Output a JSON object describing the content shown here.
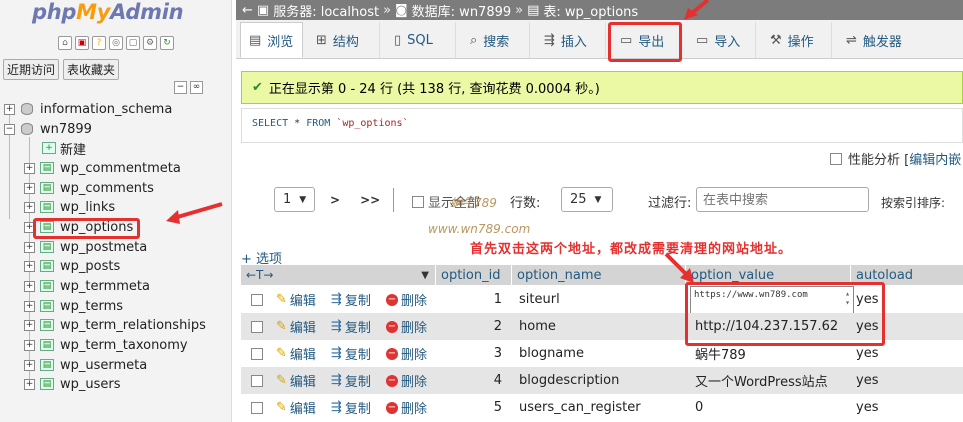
{
  "sidebar": {
    "logo_php": "php",
    "logo_my": "My",
    "logo_admin": "Admin",
    "quick_icons": [
      "home-icon",
      "exit-icon",
      "settings-icon",
      "docs-icon",
      "sql-icon",
      "gear-icon",
      "reload-icon"
    ],
    "nav_tabs": [
      "近期访问",
      "表收藏夹"
    ],
    "tree": [
      {
        "label": "information_schema",
        "type": "db",
        "expand": "+"
      },
      {
        "label": "wn7899",
        "type": "db",
        "expand": "-"
      },
      {
        "label": "新建",
        "type": "new"
      },
      {
        "label": "wp_commentmeta",
        "type": "table"
      },
      {
        "label": "wp_comments",
        "type": "table"
      },
      {
        "label": "wp_links",
        "type": "table"
      },
      {
        "label": "wp_options",
        "type": "table",
        "selected": true
      },
      {
        "label": "wp_postmeta",
        "type": "table"
      },
      {
        "label": "wp_posts",
        "type": "table"
      },
      {
        "label": "wp_termmeta",
        "type": "table"
      },
      {
        "label": "wp_terms",
        "type": "table"
      },
      {
        "label": "wp_term_relationships",
        "type": "table"
      },
      {
        "label": "wp_term_taxonomy",
        "type": "table"
      },
      {
        "label": "wp_usermeta",
        "type": "table"
      },
      {
        "label": "wp_users",
        "type": "table"
      }
    ]
  },
  "breadcrumb": {
    "server_label": "服务器: localhost",
    "db_label": "数据库: wn7899",
    "table_label": "表: wp_options"
  },
  "tabs": [
    "浏览",
    "结构",
    "SQL",
    "搜索",
    "插入",
    "导出",
    "导入",
    "操作",
    "触发器"
  ],
  "success": {
    "text": "正在显示第 0 - 24 行 (共 138 行, 查询花费 0.0004 秒。)"
  },
  "sql": {
    "select": "SELECT",
    "star": " * ",
    "from": "FROM",
    "table": "`wp_options`"
  },
  "profiling": {
    "label": "性能分析 [",
    "link": "编辑内嵌"
  },
  "pager": {
    "page": "1",
    "next": ">",
    "last": ">>",
    "show_all": "显示全部",
    "rows_label": "行数:",
    "rows_value": "25",
    "filter_label": "过滤行:",
    "filter_placeholder": "在表中搜索",
    "sort_label": "按索引排序:"
  },
  "watermark": {
    "line1": "蜗牛789",
    "line2": "www.wn789.com"
  },
  "options_link": "+ 选项",
  "annotation": "首先双击这两个地址，都改成需要清理的网站地址。",
  "table": {
    "headers": [
      "option_id",
      "option_name",
      "option_value",
      "autoload"
    ],
    "action_labels": {
      "edit": "编辑",
      "copy": "复制",
      "delete": "删除"
    },
    "rows": [
      {
        "id": "1",
        "name": "siteurl",
        "value": "https://www.wn789.com",
        "autoload": "yes"
      },
      {
        "id": "2",
        "name": "home",
        "value": "http://104.237.157.62",
        "autoload": "yes"
      },
      {
        "id": "3",
        "name": "blogname",
        "value": "蜗牛789",
        "autoload": "yes"
      },
      {
        "id": "4",
        "name": "blogdescription",
        "value": "又一个WordPress站点",
        "autoload": "yes"
      },
      {
        "id": "5",
        "name": "users_can_register",
        "value": "0",
        "autoload": "yes"
      }
    ]
  },
  "colors": {
    "accent": "#235a81",
    "annotation": "#e53030",
    "success_bg": "#ebf8a4"
  }
}
